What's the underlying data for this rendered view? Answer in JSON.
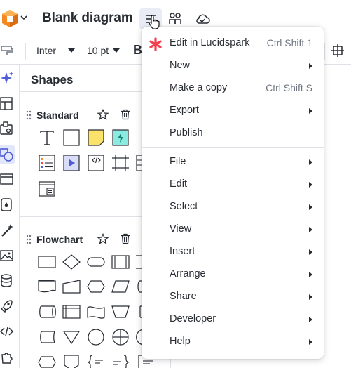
{
  "header": {
    "doc_title": "Blank diagram",
    "icons": [
      "lucid-logo-icon",
      "chevron-down-icon",
      "menu-icon",
      "people-icon",
      "cloud-icon"
    ]
  },
  "toolbar": {
    "font": "Inter",
    "font_size": "10 pt",
    "bold": "B"
  },
  "shapes_panel": {
    "title": "Shapes",
    "libraries": [
      {
        "name": "Standard"
      },
      {
        "name": "Flowchart"
      }
    ]
  },
  "menu": {
    "items": [
      {
        "label": "Edit in Lucidspark",
        "shortcut": "Ctrl Shift 1",
        "icon": "lucidspark-icon"
      },
      {
        "label": "New",
        "submenu": true
      },
      {
        "label": "Make a copy",
        "shortcut": "Ctrl Shift S"
      },
      {
        "label": "Export",
        "submenu": true
      },
      {
        "label": "Publish"
      },
      {
        "label": "File",
        "submenu": true
      },
      {
        "label": "Edit",
        "submenu": true
      },
      {
        "label": "Select",
        "submenu": true
      },
      {
        "label": "View",
        "submenu": true
      },
      {
        "label": "Insert",
        "submenu": true
      },
      {
        "label": "Arrange",
        "submenu": true
      },
      {
        "label": "Share",
        "submenu": true
      },
      {
        "label": "Developer",
        "submenu": true
      },
      {
        "label": "Help",
        "submenu": true
      }
    ]
  },
  "colors": {
    "accent": "#4d5bd6",
    "sticky_yellow": "#fbe36b",
    "lucidspark_red": "#f2404f",
    "logo_orange": "#f48a1f"
  }
}
